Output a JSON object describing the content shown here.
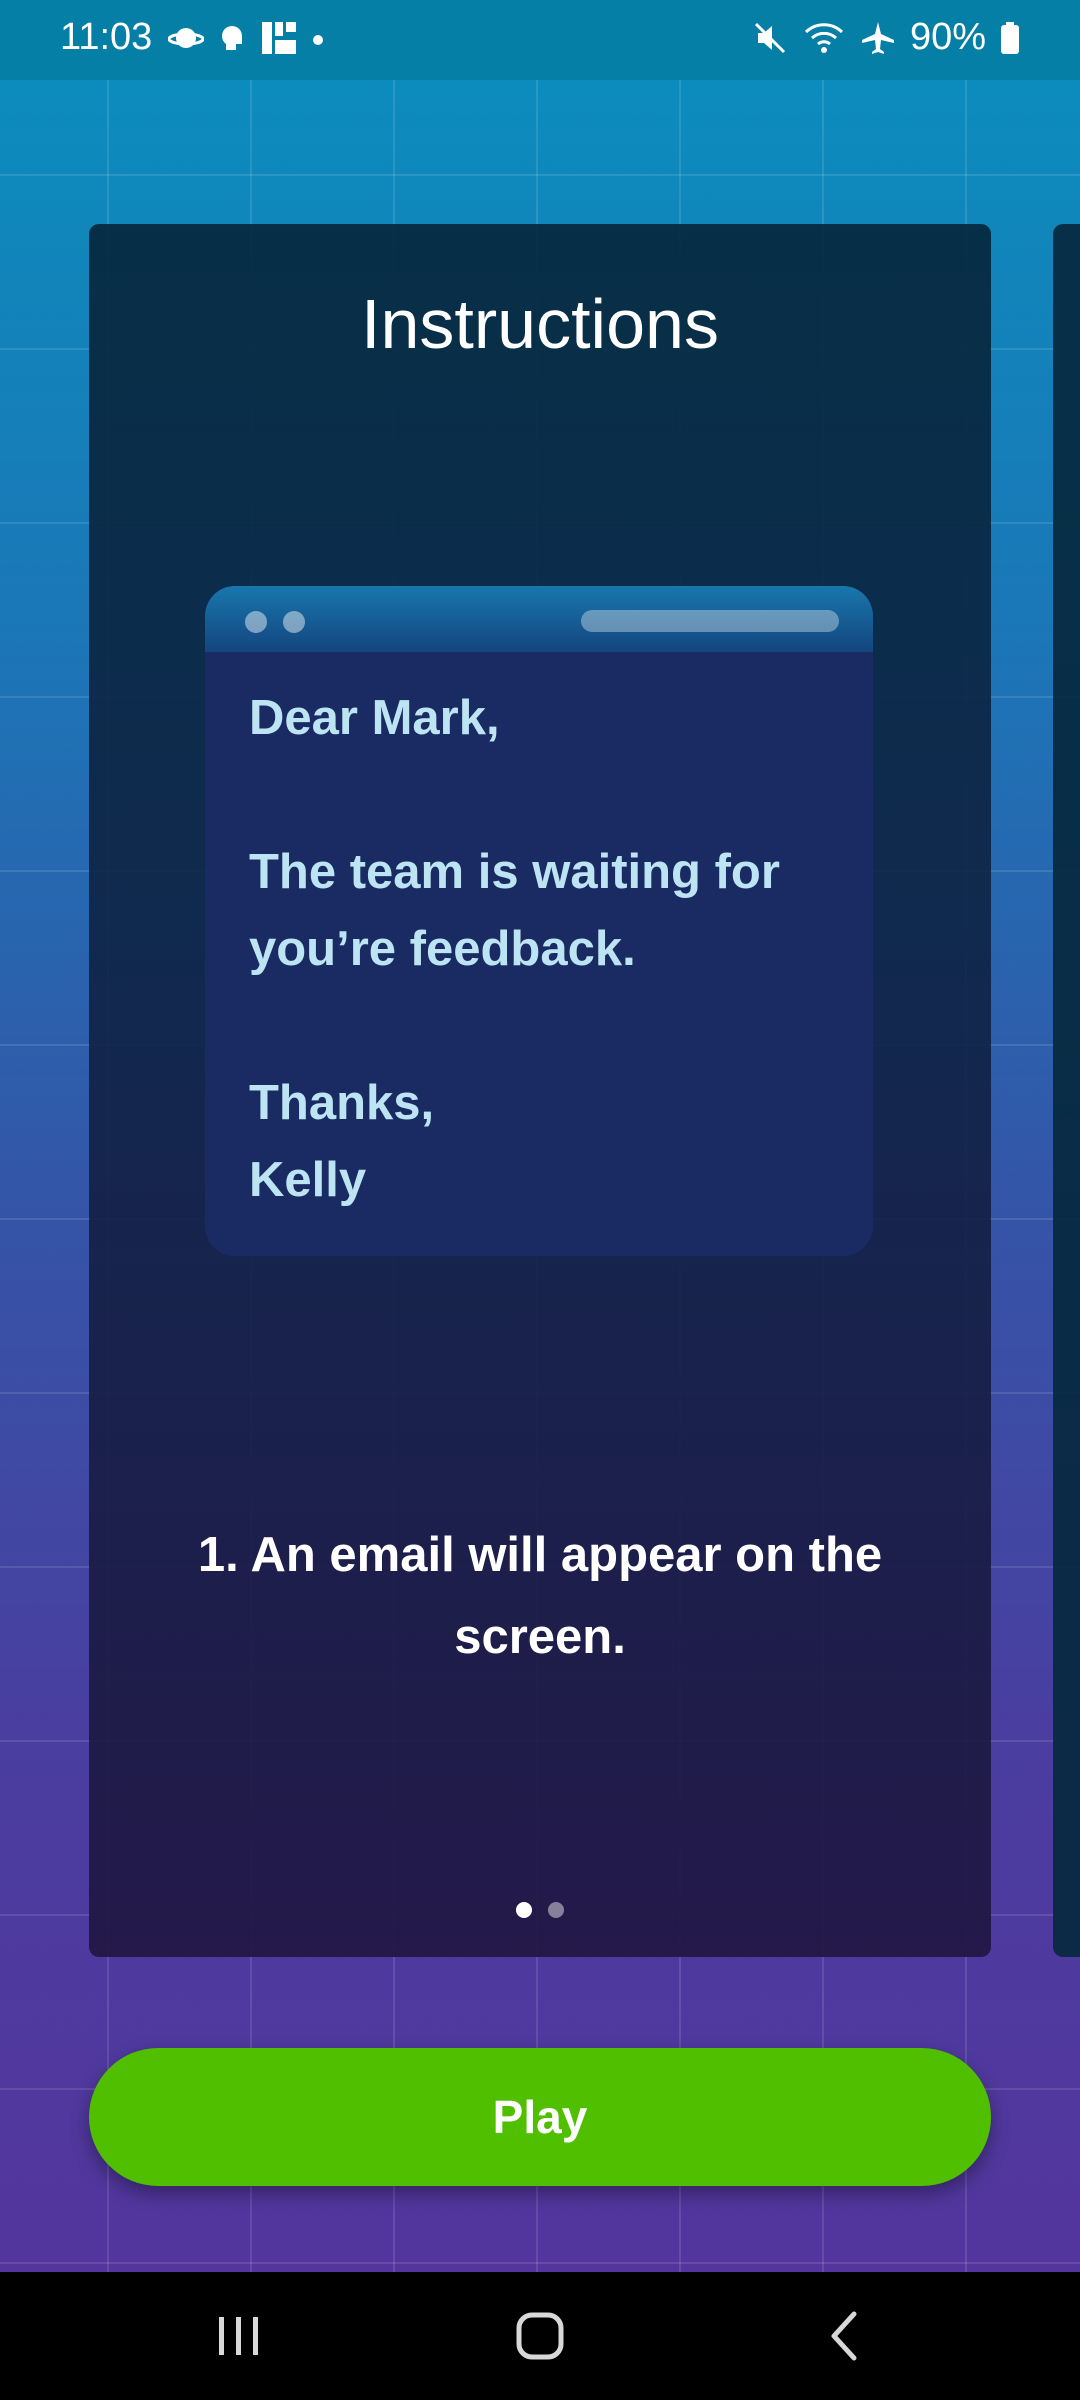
{
  "status_bar": {
    "time": "11:03",
    "battery": "90%",
    "icons_left": [
      "planet-icon",
      "head-icon",
      "app-logo-icon",
      "dot-icon"
    ],
    "icons_right": [
      "mute-icon",
      "wifi-icon",
      "airplane-icon",
      "battery-icon"
    ]
  },
  "card": {
    "title": "Instructions",
    "email": {
      "greeting": "Dear Mark,",
      "line1": "The team is waiting for",
      "line2": "you’re feedback.",
      "closing": "Thanks,",
      "signature": "Kelly"
    },
    "instruction": "1. An email will appear on the screen.",
    "pager": {
      "pages": 2,
      "current": 1
    }
  },
  "play_button": {
    "label": "Play"
  },
  "nav_bar": {
    "buttons": [
      "recent-apps",
      "home",
      "back"
    ]
  },
  "colors": {
    "play_green": "#50bf00",
    "email_text": "#bde4f2",
    "status_bar": "#057fa6"
  }
}
